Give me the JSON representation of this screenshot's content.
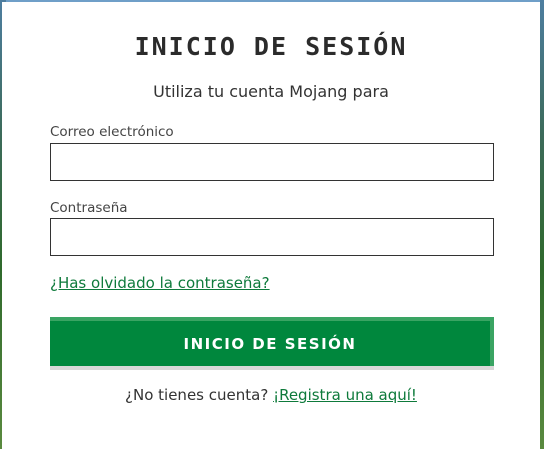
{
  "login": {
    "title": "INICIO DE SESIÓN",
    "subtitle": "Utiliza tu cuenta Mojang para",
    "email_label": "Correo electrónico",
    "email_value": "",
    "password_label": "Contraseña",
    "password_value": "",
    "forgot_link": "¿Has olvidado la contraseña?",
    "submit_label": "INICIO DE SESIÓN",
    "no_account_text": "¿No tienes cuenta?",
    "register_link": "¡Registra una aquí!"
  },
  "colors": {
    "accent": "#00873d",
    "link": "#0e7a3b"
  }
}
